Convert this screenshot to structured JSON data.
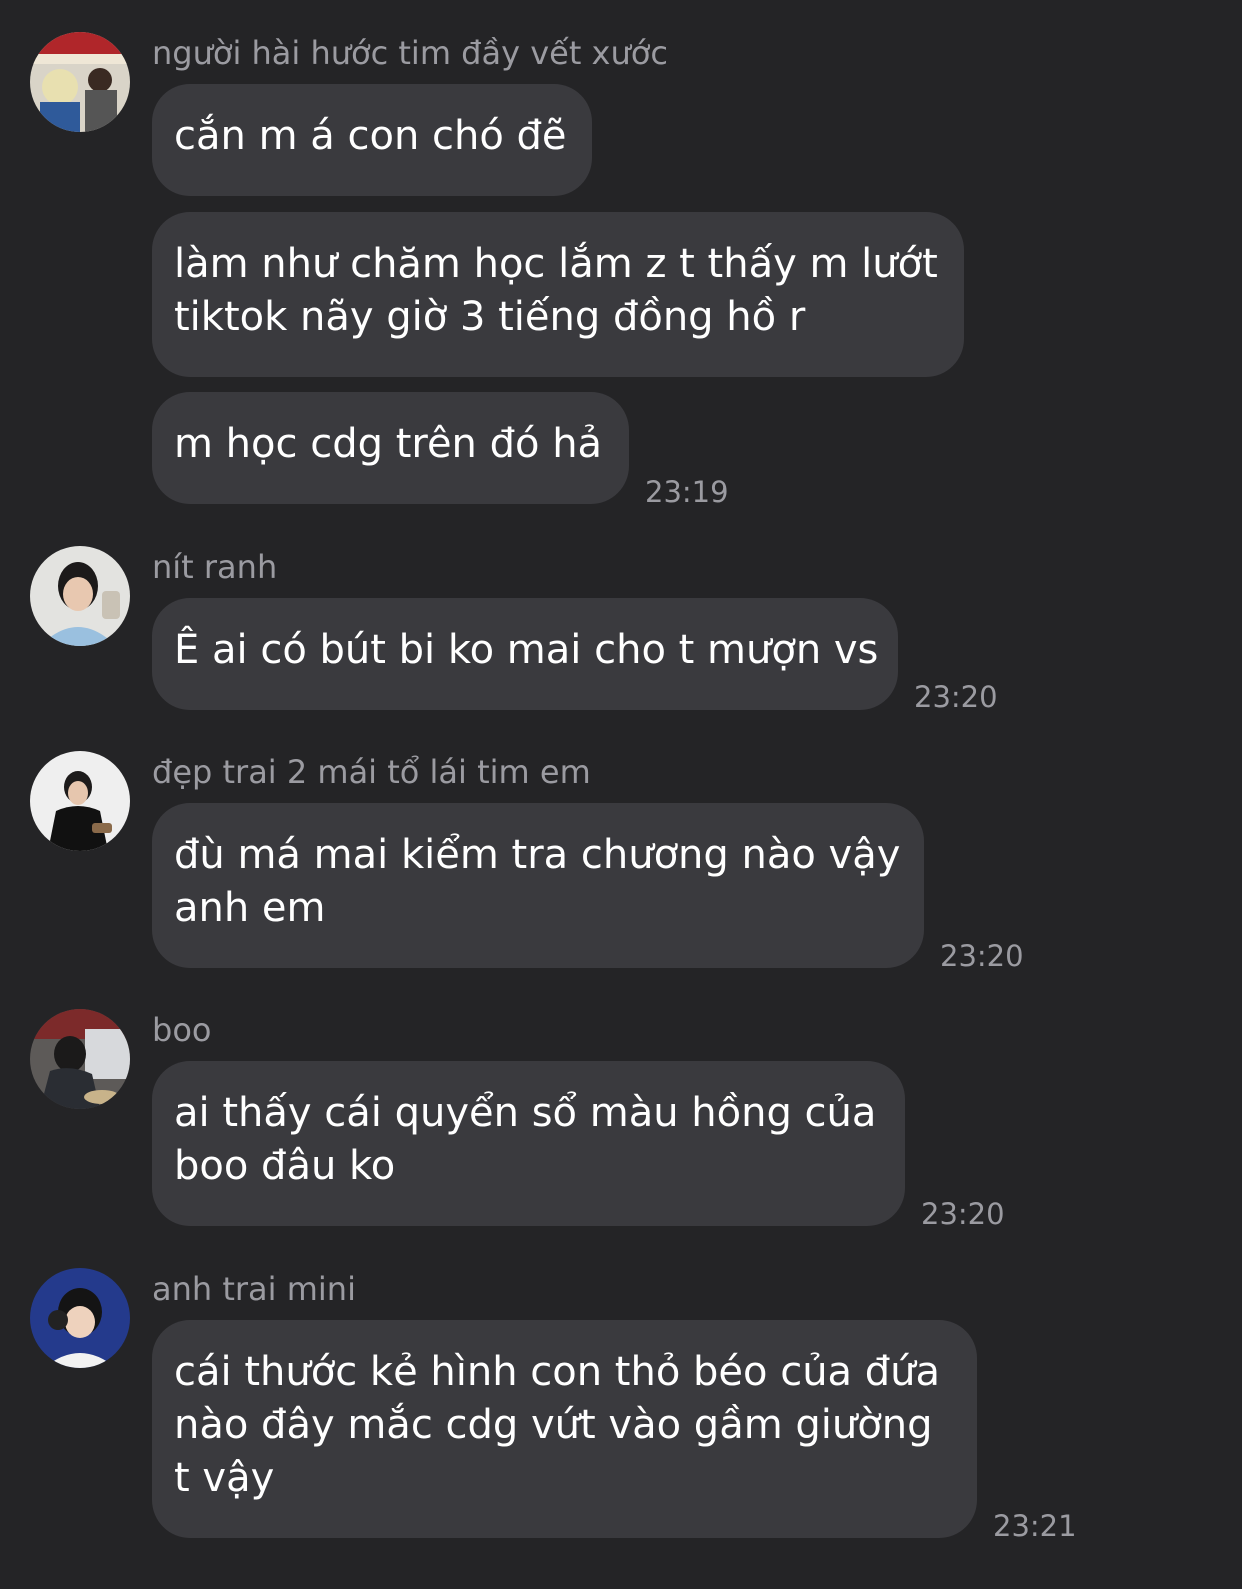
{
  "messages": [
    {
      "sender": "người hài hước tim đầy vết xước",
      "bubbles": [
        "cắn m á con chó đẽ",
        "làm như chăm học lắm z t thấy m lướt\ntiktok nãy giờ 3 tiếng đồng hồ r",
        "m học cdg trên đó hả"
      ],
      "time": "23:19"
    },
    {
      "sender": "nít ranh",
      "bubbles": [
        "Ê ai có bút bi ko mai cho t mượn vs"
      ],
      "time": "23:20"
    },
    {
      "sender": "đẹp trai 2 mái tổ lái tim em",
      "bubbles": [
        "đù má mai kiểm tra chương nào vậy\nanh em"
      ],
      "time": "23:20"
    },
    {
      "sender": "boo",
      "bubbles": [
        "ai thấy cái quyển sổ màu hồng của\nboo đâu ko"
      ],
      "time": "23:20"
    },
    {
      "sender": "anh trai mini",
      "bubbles": [
        "cái thước kẻ hình con thỏ béo của đứa\nnào đây mắc cdg vứt vào gầm giường\nt vậy"
      ],
      "time": "23:21"
    }
  ]
}
